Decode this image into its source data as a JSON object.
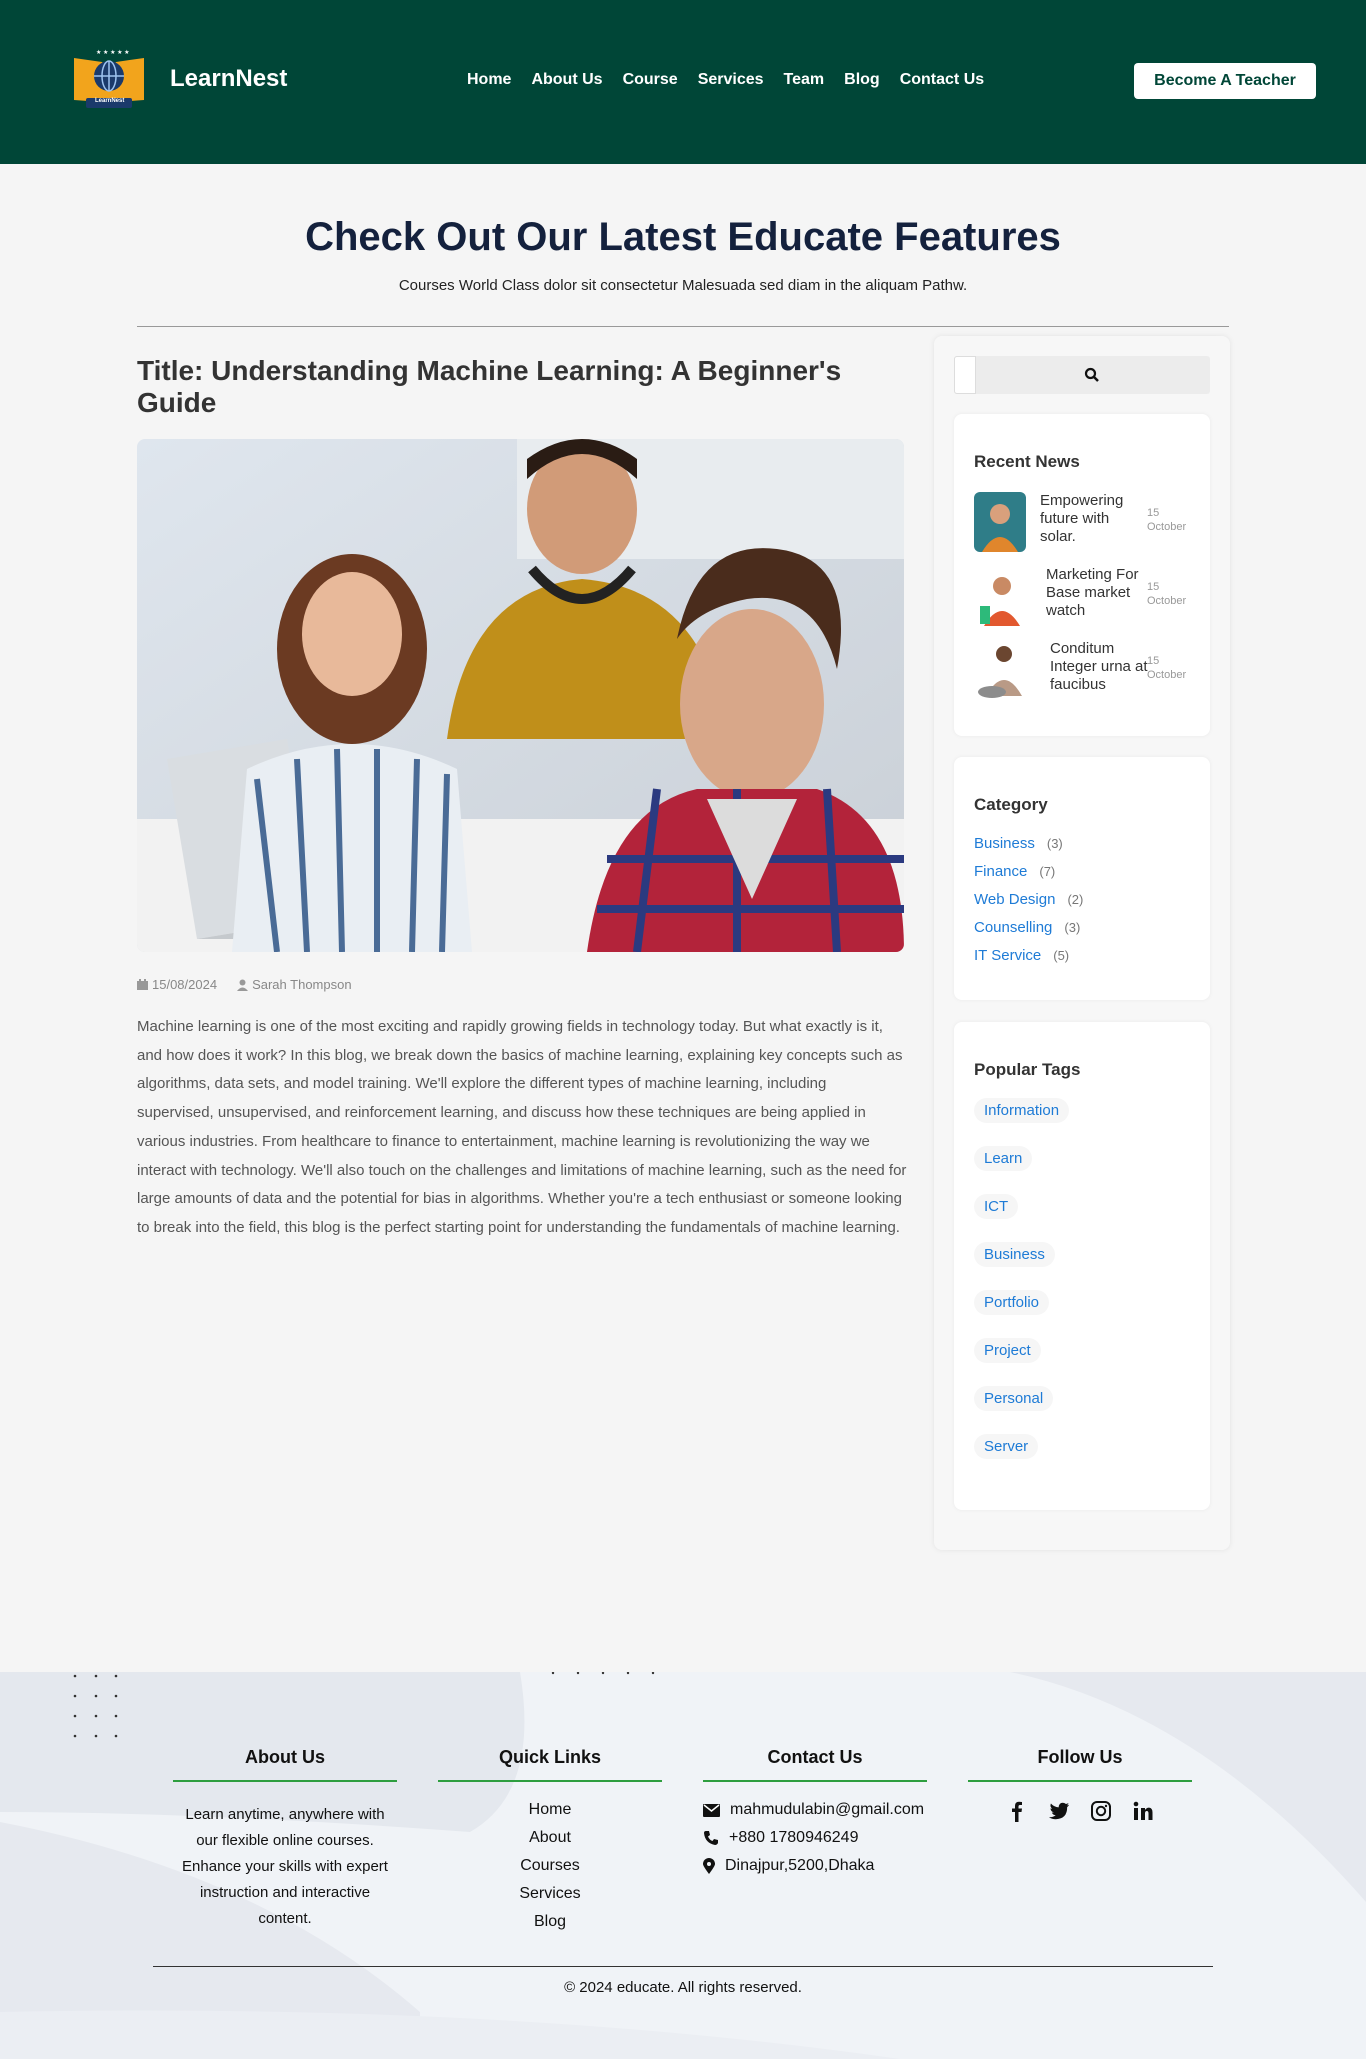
{
  "header": {
    "brand": "LearnNest",
    "logo_caption": "LearnNest",
    "nav": [
      "Home",
      "About Us",
      "Course",
      "Services",
      "Team",
      "Blog",
      "Contact Us"
    ],
    "cta": "Become A Teacher"
  },
  "hero": {
    "title": "Check Out Our Latest Educate Features",
    "subtitle": "Courses World Class dolor sit consectetur Malesuada sed diam in the aliquam Pathw."
  },
  "article": {
    "title": "Title: Understanding Machine Learning: A Beginner's Guide",
    "date": "15/08/2024",
    "author": "Sarah Thompson",
    "body": "Machine learning is one of the most exciting and rapidly growing fields in technology today. But what exactly is it, and how does it work? In this blog, we break down the basics of machine learning, explaining key concepts such as algorithms, data sets, and model training. We'll explore the different types of machine learning, including supervised, unsupervised, and reinforcement learning, and discuss how these techniques are being applied in various industries. From healthcare to finance to entertainment, machine learning is revolutionizing the way we interact with technology. We'll also touch on the challenges and limitations of machine learning, such as the need for large amounts of data and the potential for bias in algorithms. Whether you're a tech enthusiast or someone looking to break into the field, this blog is the perfect starting point for understanding the fundamentals of machine learning."
  },
  "sidebar": {
    "recent_title": "Recent News",
    "news": [
      {
        "title": "Empowering future with solar.",
        "day": "15",
        "month": "October"
      },
      {
        "title": "Marketing For Base market watch",
        "day": "15",
        "month": "October"
      },
      {
        "title": "Conditum Integer urna at faucibus",
        "day": "15",
        "month": "October"
      }
    ],
    "category_title": "Category",
    "categories": [
      {
        "name": "Business",
        "count": "(3)"
      },
      {
        "name": "Finance",
        "count": "(7)"
      },
      {
        "name": "Web Design",
        "count": "(2)"
      },
      {
        "name": "Counselling",
        "count": "(3)"
      },
      {
        "name": "IT Service",
        "count": "(5)"
      }
    ],
    "tags_title": "Popular Tags",
    "tags": [
      "Information",
      "Learn",
      "ICT",
      "Business",
      "Portfolio",
      "Project",
      "Personal",
      "Server"
    ]
  },
  "footer": {
    "about_title": "About Us",
    "about_text": "Learn anytime, anywhere with our flexible online courses. Enhance your skills with expert instruction and interactive content.",
    "links_title": "Quick Links",
    "links": [
      "Home",
      "About",
      "Courses",
      "Services",
      "Blog"
    ],
    "contact_title": "Contact Us",
    "email": "mahmudulabin@gmail.com",
    "phone": "+880 1780946249",
    "address": "Dinajpur,5200,Dhaka",
    "follow_title": "Follow Us",
    "copyright": "© 2024 educate. All rights reserved."
  },
  "colors": {
    "header_bg": "#004637",
    "link": "#1e7bd6",
    "accent_line": "#2e9e3f"
  }
}
